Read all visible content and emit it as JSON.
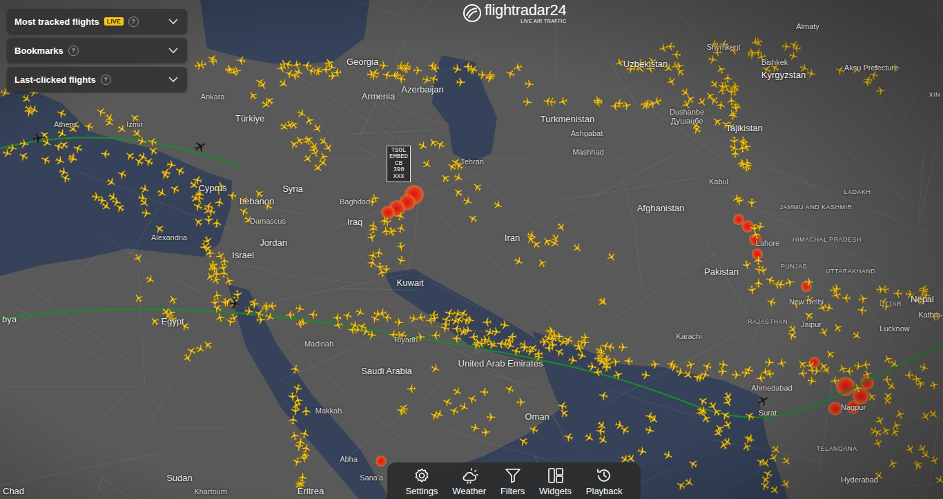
{
  "logo": {
    "name": "flightradar24",
    "tagline": "LIVE AIR TRAFFIC"
  },
  "panels": [
    {
      "label": "Most tracked flights",
      "badge": "LIVE",
      "help": "?",
      "expanded": false
    },
    {
      "label": "Bookmarks",
      "help": "?",
      "expanded": false
    },
    {
      "label": "Last-clicked flights",
      "help": "?",
      "expanded": false
    }
  ],
  "sigmet": [
    "TSOL",
    "EMBED",
    "CB",
    "390",
    "XXX"
  ],
  "toolbar": [
    {
      "label": "Settings"
    },
    {
      "label": "Weather"
    },
    {
      "label": "Filters"
    },
    {
      "label": "Widgets"
    },
    {
      "label": "Playback"
    }
  ],
  "labels": [
    {
      "text": "Georgia",
      "kind": "country"
    },
    {
      "text": "Armenia",
      "kind": "country"
    },
    {
      "text": "Azerbaijan",
      "kind": "country"
    },
    {
      "text": "Türkiye",
      "kind": "country"
    },
    {
      "text": "Ankara",
      "kind": "city"
    },
    {
      "text": "Izmir",
      "kind": "city"
    },
    {
      "text": "Athens",
      "kind": "city"
    },
    {
      "text": "Cyprus",
      "kind": "country"
    },
    {
      "text": "Turkmenistan",
      "kind": "country"
    },
    {
      "text": "Ashgabat",
      "kind": "city"
    },
    {
      "text": "Mashhad",
      "kind": "city"
    },
    {
      "text": "Uzbekistan",
      "kind": "country"
    },
    {
      "text": "Kyrgyzstan",
      "kind": "country"
    },
    {
      "text": "Bishkek",
      "kind": "city"
    },
    {
      "text": "Almaty",
      "kind": "city"
    },
    {
      "text": "Shymkent",
      "kind": "city"
    },
    {
      "text": "Tajikistan",
      "kind": "country"
    },
    {
      "text": "Dushanbe",
      "kind": "city"
    },
    {
      "text": "Душанбе",
      "kind": "city"
    },
    {
      "text": "Aksu Prefecture",
      "kind": "city"
    },
    {
      "text": "XIN",
      "kind": "region"
    },
    {
      "text": "Syria",
      "kind": "country"
    },
    {
      "text": "Lebanon",
      "kind": "country"
    },
    {
      "text": "Damascus",
      "kind": "city"
    },
    {
      "text": "Iraq",
      "kind": "country"
    },
    {
      "text": "Baghdad",
      "kind": "city"
    },
    {
      "text": "Tehran",
      "kind": "city"
    },
    {
      "text": "Iran",
      "kind": "country"
    },
    {
      "text": "Afghanistan",
      "kind": "country"
    },
    {
      "text": "Kabul",
      "kind": "city"
    },
    {
      "text": "Jordan",
      "kind": "country"
    },
    {
      "text": "Israel",
      "kind": "country"
    },
    {
      "text": "Egypt",
      "kind": "country"
    },
    {
      "text": "Alexandria",
      "kind": "city"
    },
    {
      "text": "bya",
      "kind": "country"
    },
    {
      "text": "Kuwait",
      "kind": "country"
    },
    {
      "text": "Riyadh",
      "kind": "city"
    },
    {
      "text": "Saudi Arabia",
      "kind": "country"
    },
    {
      "text": "Madinah",
      "kind": "city"
    },
    {
      "text": "Makkah",
      "kind": "city"
    },
    {
      "text": "Abha",
      "kind": "city"
    },
    {
      "text": "Sana'a",
      "kind": "city"
    },
    {
      "text": "United Arab Emirates",
      "kind": "country"
    },
    {
      "text": "Oman",
      "kind": "country"
    },
    {
      "text": "Pakistan",
      "kind": "country"
    },
    {
      "text": "Karachi",
      "kind": "city"
    },
    {
      "text": "Lahore",
      "kind": "city"
    },
    {
      "text": "New Delhi",
      "kind": "city"
    },
    {
      "text": "Jaipur",
      "kind": "city"
    },
    {
      "text": "Ahmedabad",
      "kind": "city"
    },
    {
      "text": "Surat",
      "kind": "city"
    },
    {
      "text": "Hyderabad",
      "kind": "city"
    },
    {
      "text": "Nepal",
      "kind": "country"
    },
    {
      "text": "Kathm",
      "kind": "city"
    },
    {
      "text": "Sudan",
      "kind": "country"
    },
    {
      "text": "Khartoum",
      "kind": "city"
    },
    {
      "text": "Eritrea",
      "kind": "country"
    },
    {
      "text": "Chad",
      "kind": "country"
    },
    {
      "text": "RAJASTHAN",
      "kind": "region"
    },
    {
      "text": "UTTARAKHAND",
      "kind": "region"
    },
    {
      "text": "JAMMU AND KASHMIR",
      "kind": "region"
    },
    {
      "text": "HIMACHAL PRADESH",
      "kind": "region"
    },
    {
      "text": "PUNJAB",
      "kind": "region"
    },
    {
      "text": "LADAKH",
      "kind": "region"
    },
    {
      "text": "UTTAR",
      "kind": "region"
    },
    {
      "text": "Lucknow",
      "kind": "city"
    },
    {
      "text": "TELANGANA",
      "kind": "region"
    },
    {
      "text": "Nagpur",
      "kind": "city"
    }
  ]
}
